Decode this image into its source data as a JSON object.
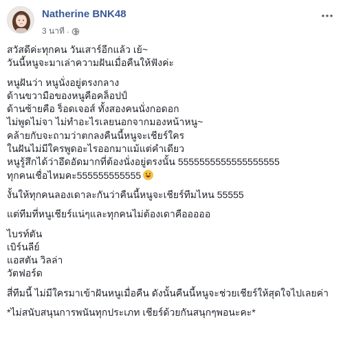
{
  "post": {
    "author": "Natherine BNK48",
    "time": "3 นาที",
    "separator": "·",
    "privacy_icon": "globe-icon",
    "more_icon": "more-options-icon",
    "paragraphs": [
      {
        "lines": [
          "สวัสดีค่ะทุกคน วันเสาร์อีกแล้ว เย้~",
          "วันนี้หนูจะมาเล่าความฝันเมื่อคืนให้ฟังค่ะ"
        ]
      },
      {
        "lines": [
          "หนูฝันว่า หนูนั่งอยู่ตรงกลาง",
          "ด้านขวามือของหนูคือคล็อปป์",
          "ด้านซ้ายคือ ร็อดเจอส์ ทั้งสองคนนั่งกอดอก",
          "ไม่พูดไม่จา ไม่ทำอะไรเลยนอกจากมองหน้าหนู~",
          "คล้ายกับจะถามว่าตกลงคืนนี้หนูจะเชียร์ใคร",
          "ในฝันไม่มีใครพูดอะไรออกมาแม้แต่คำเดียว",
          "หนูรู้สึกได้ว่าอึดอัดมากที่ต้องนั่งอยู่ตรงนั้น 5555555555555555555",
          "ทุกคนเชื่อไหมคะ555555555555"
        ]
      },
      {
        "lines": [
          "งั้นให้ทุกคนลองเดาละกันว่าคืนนี้หนูจะเชียร์ทีมไหน 55555"
        ]
      },
      {
        "lines": [
          "แต่ทีมที่หนูเชียร์แน่ๆและทุกคนไม่ต้องเดาคือออออ"
        ]
      },
      {
        "lines": [
          "ไบรท์ตัน",
          "เบิร์นลีย์",
          "แอสตัน วิลล่า",
          "วัตฟอร์ด"
        ]
      },
      {
        "lines": [
          "สี่ทีมนี้ ไม่มีใครมาเข้าฝันหนูเมื่อคืน ดังนั้นคืนนี้หนูจะช่วยเชียร์ให้สุดใจไปเลยค่า"
        ]
      },
      {
        "lines": [
          "*ไม่สนับสนุนการพนันทุกประเภท เชียร์ด้วยกันสนุกๆพอนะคะ*"
        ]
      }
    ],
    "emoji": "grinning-face-emoji"
  },
  "colors": {
    "author": "#385898",
    "text": "#1d2129",
    "meta": "#616770"
  }
}
